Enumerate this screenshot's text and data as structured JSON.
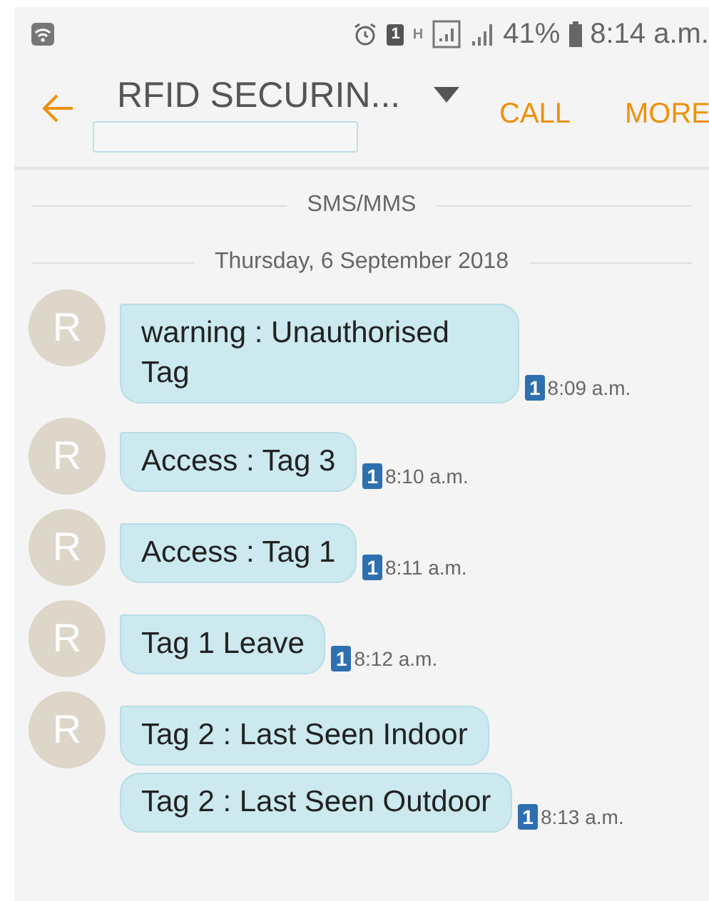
{
  "status_bar": {
    "sim": "1",
    "network": "H",
    "battery": "41%",
    "time": "8:14 a.m."
  },
  "header": {
    "title": "RFID SECURIN...",
    "actions": [
      "CALL",
      "MORE"
    ]
  },
  "channel_label": "SMS/MMS",
  "date": "Thursday, 6 September 2018",
  "messages": [
    {
      "avatar": "R",
      "bubbles": [
        "warning : Unauthorised Tag"
      ],
      "sim": "1",
      "time": "8:09 a.m."
    },
    {
      "avatar": "R",
      "bubbles": [
        "Access :  Tag 3"
      ],
      "sim": "1",
      "time": "8:10 a.m."
    },
    {
      "avatar": "R",
      "bubbles": [
        "Access :  Tag 1"
      ],
      "sim": "1",
      "time": "8:11 a.m."
    },
    {
      "avatar": "R",
      "bubbles": [
        "Tag 1 Leave"
      ],
      "sim": "1",
      "time": "8:12 a.m."
    },
    {
      "avatar": "R",
      "bubbles": [
        "Tag 2 : Last Seen Indoor",
        "Tag 2 : Last Seen Outdoor"
      ],
      "sim": "1",
      "time": "8:13 a.m."
    }
  ]
}
